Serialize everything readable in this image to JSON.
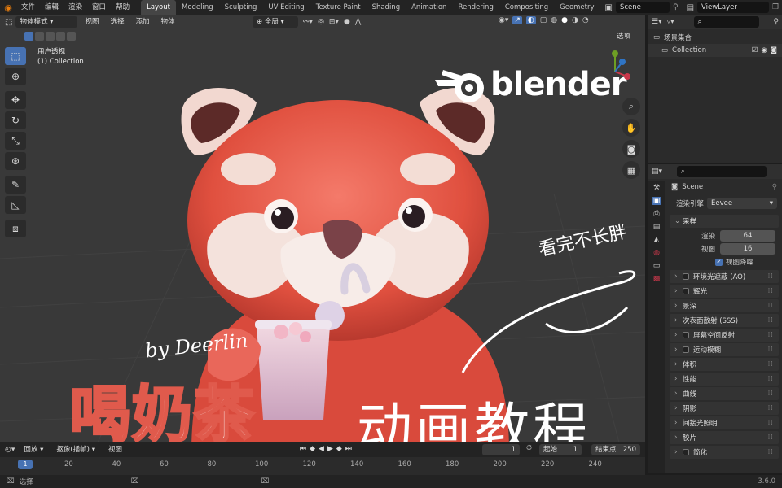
{
  "menus": [
    "文件",
    "编辑",
    "渲染",
    "窗口",
    "帮助"
  ],
  "workspace_tabs": [
    "Layout",
    "Modeling",
    "Sculpting",
    "UV Editing",
    "Texture Paint",
    "Shading",
    "Animation",
    "Rendering",
    "Compositing",
    "Geometry"
  ],
  "active_tab": "Layout",
  "scene_field": "Scene",
  "view_layer_field": "ViewLayer",
  "viewport": {
    "mode": "物体模式",
    "menus": [
      "视图",
      "选择",
      "添加",
      "物体"
    ],
    "orientation": "全局",
    "options_label": "选项",
    "view_name": "用户透视",
    "collection_label": "(1) Collection"
  },
  "overlay": {
    "brand": "blender",
    "byline": "by Deerlin",
    "title_left": "喝奶茶",
    "title_right": "动画教程",
    "caption": "看完不长胖"
  },
  "outliner": {
    "scene_collection": "场景集合",
    "collection": "Collection"
  },
  "properties": {
    "scene_name": "Scene",
    "render_engine_label": "渲染引擎",
    "render_engine_value": "Eevee",
    "sampling_label": "采样",
    "render_label": "渲染",
    "render_value": "64",
    "viewport_label": "视图",
    "viewport_value": "16",
    "denoise_label": "视图降噪",
    "panels": [
      {
        "label": "环境光遮蔽 (AO)",
        "checkbox": true
      },
      {
        "label": "辉光",
        "checkbox": true
      },
      {
        "label": "景深",
        "checkbox": false
      },
      {
        "label": "次表面散射 (SSS)",
        "checkbox": false
      },
      {
        "label": "屏幕空间反射",
        "checkbox": true
      },
      {
        "label": "运动模糊",
        "checkbox": true
      },
      {
        "label": "体积",
        "checkbox": false
      },
      {
        "label": "性能",
        "checkbox": false
      },
      {
        "label": "曲线",
        "checkbox": false
      },
      {
        "label": "阴影",
        "checkbox": false
      },
      {
        "label": "间接光照明",
        "checkbox": false
      },
      {
        "label": "胶片",
        "checkbox": false
      },
      {
        "label": "简化",
        "checkbox": true
      }
    ]
  },
  "timeline": {
    "playback": "回放",
    "keying": "抠像(插帧)",
    "view": "视图",
    "current_frame": "1",
    "start_label": "起始",
    "start_value": "1",
    "end_label": "结束点",
    "end_value": "250",
    "ticks": [
      "20",
      "40",
      "60",
      "80",
      "100",
      "120",
      "140",
      "160",
      "180",
      "200",
      "220",
      "240"
    ]
  },
  "status": {
    "left": "选择",
    "version": "3.6.0"
  },
  "colors": {
    "accent": "#4772b3",
    "fur": "#e8584c",
    "bg_dark": "#1d1d1d"
  }
}
